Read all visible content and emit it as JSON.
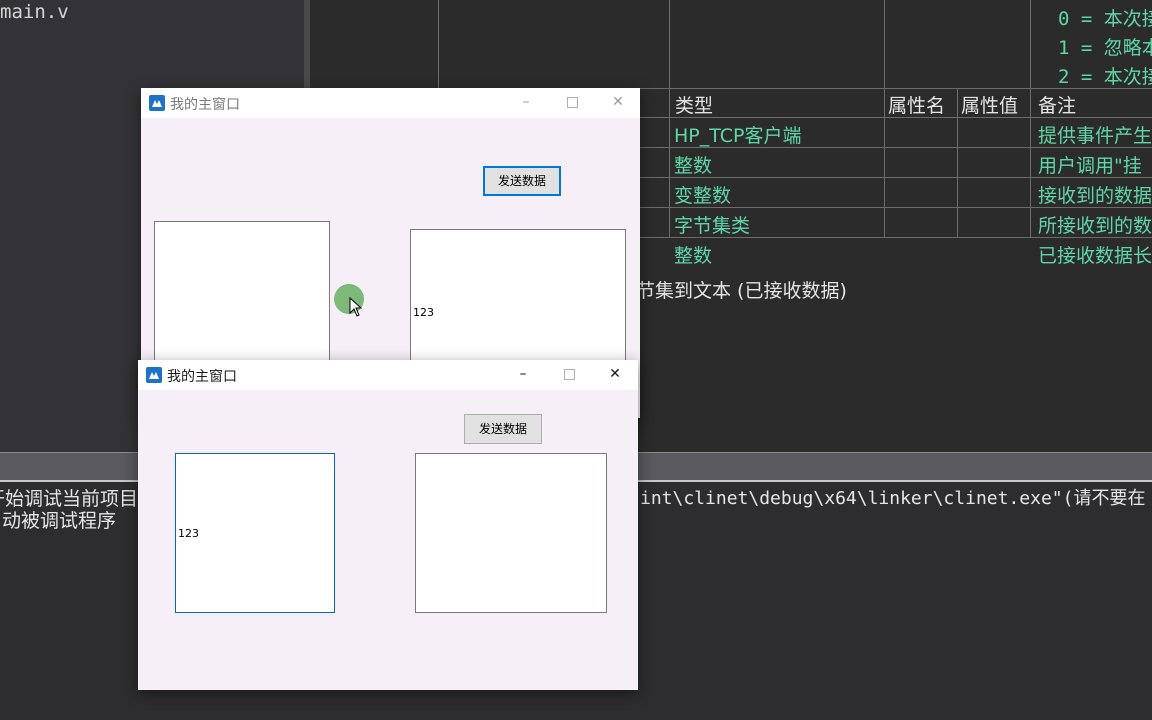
{
  "ide": {
    "left_file_label": "main.v",
    "table": {
      "remarks_top": [
        "0 = 本次接",
        "1 = 忽略本",
        "2 = 本次接"
      ],
      "headers": [
        "类型",
        "属性名",
        "属性值",
        "备注"
      ],
      "rows": [
        {
          "type": "HP_TCP客户端",
          "remark": "提供事件产生"
        },
        {
          "type": "整数",
          "remark": "用户调用\"挂"
        },
        {
          "type": "变整数",
          "remark": "接收到的数据"
        },
        {
          "type": "字节集类",
          "remark": "所接收到的数"
        },
        {
          "type": "整数",
          "remark": "已接收数据长"
        }
      ],
      "code_line": "节集到文本 (已接收数据)"
    },
    "output_lines": [
      "开始调试当前项目",
      "动被调试程序"
    ],
    "output_path": "int\\clinet\\debug\\x64\\linker\\clinet.exe\"(请不要在"
  },
  "window_back": {
    "title": "我的主窗口",
    "send_button": "发送数据",
    "right_box_text": "123"
  },
  "window_front": {
    "title": "我的主窗口",
    "send_button": "发送数据",
    "left_box_text": "123"
  },
  "colors": {
    "table_text": "#5fd7a5",
    "window_bg": "#f7eff7",
    "accent": "#0078d7"
  }
}
